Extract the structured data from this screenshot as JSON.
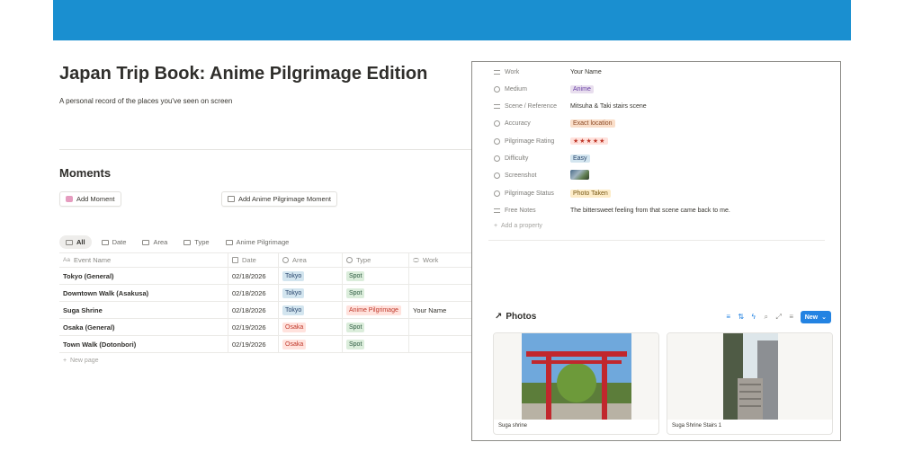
{
  "page": {
    "title": "Japan Trip Book: Anime Pilgrimage Edition",
    "description": "A personal record of the places you've seen on screen",
    "banner_color": "#1a8fd0"
  },
  "moments": {
    "heading": "Moments",
    "add_moment_label": "Add Moment",
    "add_anime_label": "Add Anime Pilgrimage Moment",
    "tabs": [
      {
        "label": "All",
        "active": true
      },
      {
        "label": "Date"
      },
      {
        "label": "Area"
      },
      {
        "label": "Type"
      },
      {
        "label": "Anime Pilgrimage"
      }
    ],
    "columns": {
      "name": "Event Name",
      "date": "Date",
      "area": "Area",
      "type": "Type",
      "work": "Work"
    },
    "rows": [
      {
        "name": "Tokyo (General)",
        "date": "02/18/2026",
        "area": "Tokyo",
        "type": "Spot",
        "work": ""
      },
      {
        "name": "Downtown Walk (Asakusa)",
        "date": "02/18/2026",
        "area": "Tokyo",
        "type": "Spot",
        "work": ""
      },
      {
        "name": "Suga Shrine",
        "date": "02/18/2026",
        "area": "Tokyo",
        "type": "Anime Pilgrimage",
        "work": "Your Name"
      },
      {
        "name": "Osaka (General)",
        "date": "02/19/2026",
        "area": "Osaka",
        "type": "Spot",
        "work": ""
      },
      {
        "name": "Town Walk (Dotonbori)",
        "date": "02/19/2026",
        "area": "Osaka",
        "type": "Spot",
        "work": ""
      }
    ],
    "new_page_label": "New page"
  },
  "properties": [
    {
      "label": "Work",
      "value": "Your Name",
      "icon": "lines-icon"
    },
    {
      "label": "Medium",
      "value": "Anime",
      "icon": "select-icon"
    },
    {
      "label": "Scene / Reference",
      "value": "Mitsuha & Taki stairs scene",
      "icon": "lines-icon"
    },
    {
      "label": "Accuracy",
      "value": "Exact location",
      "icon": "select-icon"
    },
    {
      "label": "Pilgrimage Rating",
      "value": "★★★★★",
      "icon": "select-icon"
    },
    {
      "label": "Difficulty",
      "value": "Easy",
      "icon": "select-icon"
    },
    {
      "label": "Screenshot",
      "value": "",
      "icon": "paperclip-icon"
    },
    {
      "label": "Pilgrimage Status",
      "value": "Photo Taken",
      "icon": "status-icon"
    },
    {
      "label": "Free Notes",
      "value": "The bittersweet feeling from that scene came back to me.",
      "icon": "lines-icon"
    }
  ],
  "add_property_label": "Add a property",
  "photos": {
    "heading": "Photos",
    "new_label": "New",
    "cards": [
      {
        "title": "Suga shrine"
      },
      {
        "title": "Suga Shrine Stairs 1"
      }
    ]
  }
}
